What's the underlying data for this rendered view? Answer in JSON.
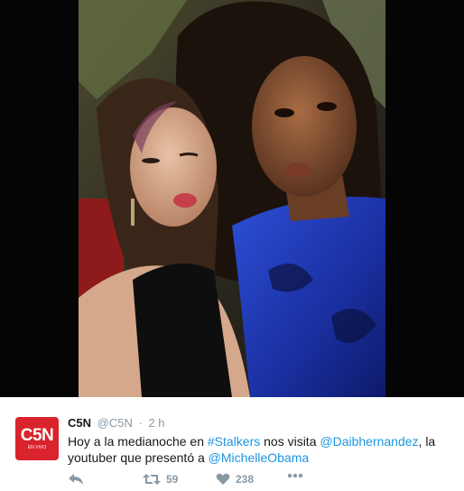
{
  "tweet": {
    "author_name": "C5N",
    "handle": "@C5N",
    "separator": "·",
    "time": "2 h",
    "avatar": {
      "logo_text": "C5N",
      "sub_text": "EN VIVO",
      "color": "#d9232d"
    },
    "text": {
      "part1": "Hoy a la medianoche en ",
      "hashtag": "#Stalkers",
      "part2": " nos visita ",
      "mention1": "@Daibhernandez",
      "part3": ", la youtuber que presentó a ",
      "mention2": "@MichelleObama"
    },
    "actions": {
      "reply_icon": "reply-icon",
      "retweet_icon": "retweet-icon",
      "retweet_count": "59",
      "like_icon": "heart-icon",
      "like_count": "238",
      "more_icon": "more-icon"
    }
  },
  "colors": {
    "link": "#1b95e0",
    "text": "#14171a",
    "muted": "#8899a6",
    "media_background": "#050505"
  }
}
